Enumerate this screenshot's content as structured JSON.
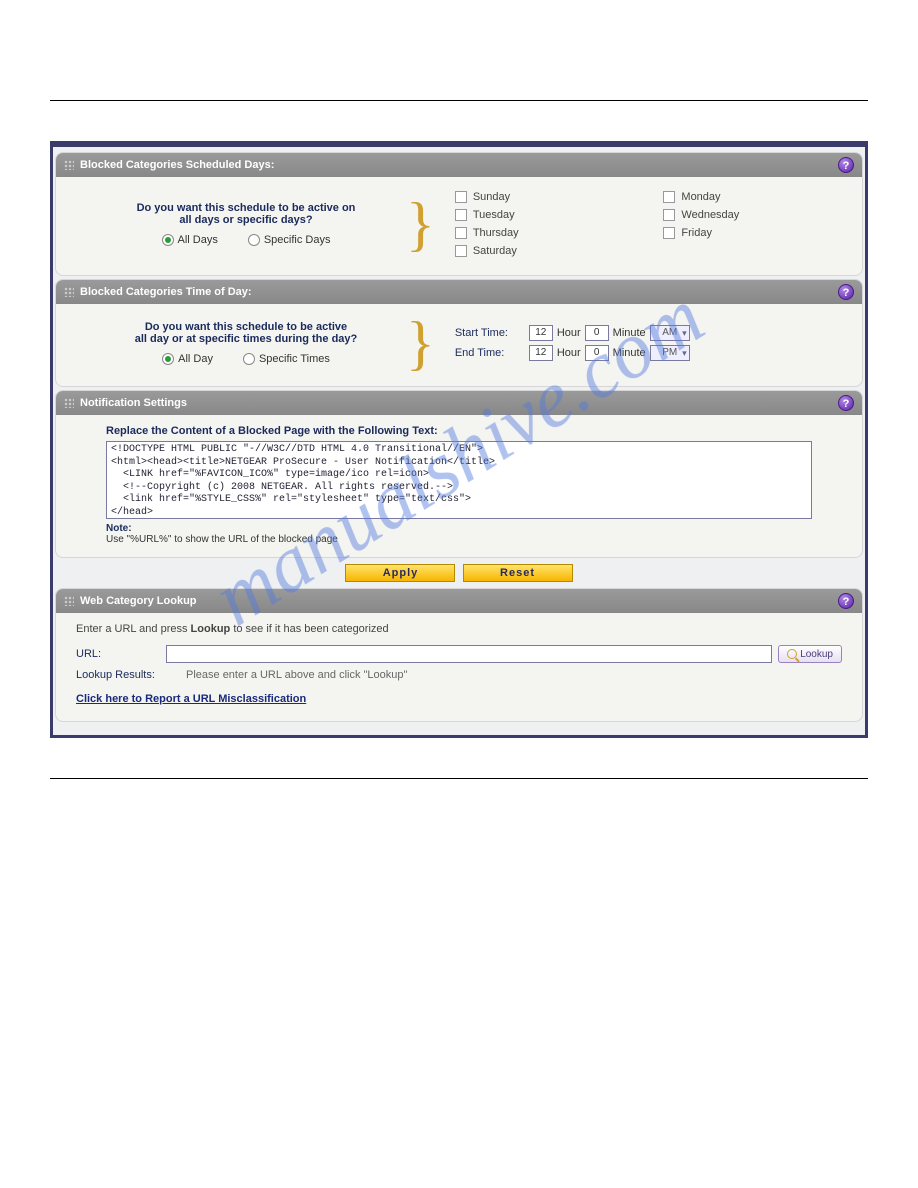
{
  "watermark": "manualshive.com",
  "panels": {
    "days": {
      "title": "Blocked Categories Scheduled Days:",
      "question_l1": "Do you want this schedule to be active on",
      "question_l2": "all days or specific days?",
      "radio_all": "All Days",
      "radio_specific": "Specific Days",
      "selected": "all",
      "day_labels": {
        "sun": "Sunday",
        "mon": "Monday",
        "tue": "Tuesday",
        "wed": "Wednesday",
        "thu": "Thursday",
        "fri": "Friday",
        "sat": "Saturday"
      }
    },
    "time": {
      "title": "Blocked Categories Time of Day:",
      "question_l1": "Do you want this schedule to be active",
      "question_l2": "all day or at specific times during the day?",
      "radio_all": "All Day",
      "radio_specific": "Specific Times",
      "selected": "all",
      "labels": {
        "start": "Start Time:",
        "end": "End Time:",
        "hour": "Hour",
        "minute": "Minute"
      },
      "start": {
        "hour": "12",
        "minute": "0",
        "ampm": "AM"
      },
      "end": {
        "hour": "12",
        "minute": "0",
        "ampm": "PM"
      }
    },
    "notif": {
      "title": "Notification Settings",
      "label": "Replace the Content of a Blocked Page with the Following Text:",
      "content": "<!DOCTYPE HTML PUBLIC \"-//W3C//DTD HTML 4.0 Transitional//EN\">\n<html><head><title>NETGEAR ProSecure - User Notification</title>\n  <LINK href=\"%FAVICON_ICO%\" type=image/ico rel=icon>\n  <!--Copyright (c) 2008 NETGEAR. All rights reserved.-->\n  <link href=\"%STYLE_CSS%\" rel=\"stylesheet\" type=\"text/css\">\n</head>",
      "note_label": "Note:",
      "note_text": "Use \"%URL%\" to show the URL of the blocked page"
    },
    "buttons": {
      "apply": "Apply",
      "reset": "Reset"
    },
    "lookup": {
      "title": "Web Category Lookup",
      "intro_pre": "Enter a URL and press ",
      "intro_bold": "Lookup",
      "intro_post": " to see if it has been categorized",
      "url_label": "URL:",
      "lookup_btn": "Lookup",
      "results_label": "Lookup Results:",
      "results_text": "Please enter a URL above and click \"Lookup\"",
      "report_link": "Click here to Report a URL Misclassification"
    }
  }
}
